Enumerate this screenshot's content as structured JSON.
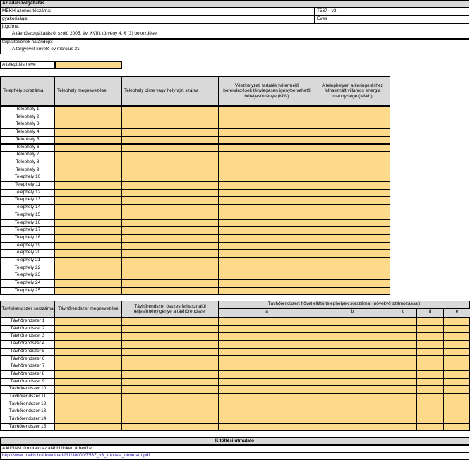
{
  "info": {
    "title": "Az adatszolgáltatás",
    "rows": [
      {
        "label": "MEKH azonosítószáma:",
        "value": "T537 - v3"
      },
      {
        "label": "gyakorisága:",
        "value": "Éves"
      }
    ],
    "legal_label": "jogcíme:",
    "legal_text": "A távhőszolgáltatásról szóló 2005. évi XVIII. törvény 4. § (3) bekezdése.",
    "deadline_label": "teljesítésének határideje:",
    "deadline_text": "A tárgyévet követő év március 31."
  },
  "settlement": {
    "label": "A település neve",
    "value": ""
  },
  "table1": {
    "headers": [
      "Telephely sorszáma",
      "Telephely megnevezése",
      "Telephely címe vagy helyrajzi száma",
      "Vészhelyzeti tartalék hőtermelő berendezések ténylegesen igénybe vehető hőteljesítménye (MW)",
      "A telephelyen a keringetéshez felhasznált villamos energia mennyisége (MWh)"
    ],
    "rows": [
      "Telephely 1",
      "Telephely 2",
      "Telephely 3",
      "Telephely 4",
      "Telephely 5",
      "Telephely 6",
      "Telephely 7",
      "Telephely 8",
      "Telephely 9",
      "Telephely 10",
      "Telephely 11",
      "Telephely 12",
      "Telephely 13",
      "Telephely 14",
      "Telephely 15",
      "Telephely 16",
      "Telephely 17",
      "Telephely 18",
      "Telephely 19",
      "Telephely 20",
      "Telephely 21",
      "Telephely 22",
      "Telephely 23",
      "Telephely 24",
      "Telephely 25"
    ]
  },
  "table2": {
    "headers": [
      "Távhőrendszer sorszáma",
      "Távhőrendszer megnevezése",
      "Távhőrendszer összes felhasználói teljesítményigénye a távhőrendszer",
      "Távhőrendszert hővel ellátó telephelyek sorszámai (növekvő számozással)"
    ],
    "sub_headers": [
      "a",
      "b",
      "c",
      "d",
      "e"
    ],
    "rows": [
      "Távhőrendszer 1",
      "Távhőrendszer 2",
      "Távhőrendszer 3",
      "Távhőrendszer 4",
      "Távhőrendszer 5",
      "Távhőrendszer 6",
      "Távhőrendszer 7",
      "Távhőrendszer 8",
      "Távhőrendszer 9",
      "Távhőrendszer 10",
      "Távhőrendszer 11",
      "Távhőrendszer 12",
      "Távhőrendszer 13",
      "Távhőrendszer 14",
      "Távhőrendszer 15"
    ]
  },
  "guide": {
    "title": "Kitöltési útmutató",
    "text": "A kitöltési útmutató az alábbi linken érhető el:",
    "link": "http://www.mekh.hu/download/f/f1/30000/T537_v3_kitoltesi_utmutato.pdf"
  },
  "colors": {
    "input_fill": "#fdd98c",
    "header_fill": "#d9d9d9"
  }
}
